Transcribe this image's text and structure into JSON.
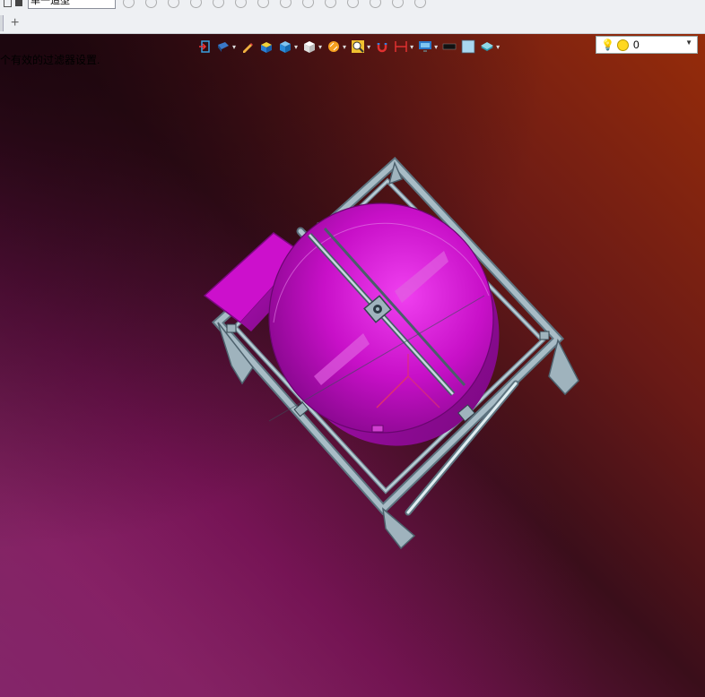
{
  "selection_bar": {
    "filter_value": "单一造型"
  },
  "tabs": {
    "add_label": "+"
  },
  "viewport": {
    "status_message": "个有效的过滤器设置."
  },
  "view_toolbar": {
    "icons": [
      "exit-icon",
      "view-orient-icon",
      "sketch-pencil-icon",
      "shaded-box-icon",
      "display-style-icon",
      "wireframe-cube-icon",
      "light-orb-icon",
      "zoom-view-icon",
      "magnet-icon",
      "dimension-icon",
      "monitor-icon",
      "black-rect-icon",
      "light-square-icon",
      "layer-stack-icon"
    ]
  },
  "layer_combo": {
    "value": "0"
  },
  "colors": {
    "accent_part": "#cc10cc",
    "frame_steel": "#9fb3bd",
    "background_top_right": "#962c0a",
    "background_bottom_left": "#8a1868"
  }
}
